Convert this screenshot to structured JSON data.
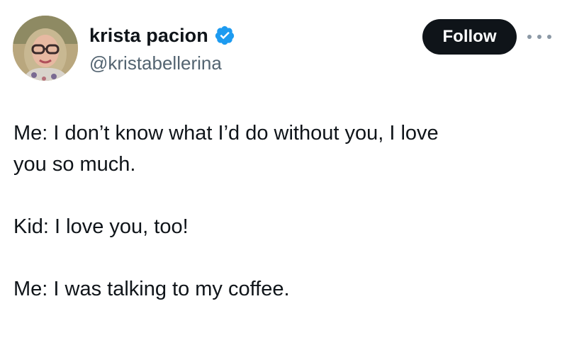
{
  "author": {
    "display_name": "krista pacion",
    "handle": "@kristabellerina",
    "verified": true,
    "avatar_icon": "profile-photo"
  },
  "actions": {
    "follow_label": "Follow",
    "more_icon": "ellipsis-icon"
  },
  "tweet": {
    "lines": [
      "Me: I don’t know what I’d do without you, I love",
      "you so much.",
      "Kid: I love you, too!",
      "Me: I was talking to my coffee."
    ]
  },
  "colors": {
    "verified_badge": "#1d9bf0",
    "follow_button_bg": "#0f1419",
    "handle_text": "#536471"
  }
}
